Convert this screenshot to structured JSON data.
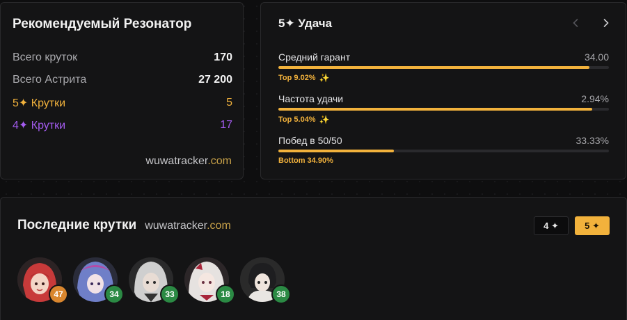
{
  "resonator": {
    "title": "Рекомендуемый Резонатор",
    "stats": [
      {
        "label": "Всего круток",
        "value": "170"
      },
      {
        "label": "Всего Астрита",
        "value": "27 200"
      },
      {
        "label": "5✦ Крутки",
        "value": "5"
      },
      {
        "label": "4✦ Крутки",
        "value": "17"
      }
    ],
    "brand_name": "wuwatracker",
    "brand_domain": ".com"
  },
  "luck": {
    "title": "5✦ Удача",
    "prev_icon": "chevron-left-icon",
    "next_icon": "chevron-right-icon",
    "metrics": [
      {
        "label": "Средний гарант",
        "value": "34.00",
        "rank": "Top 9.02%",
        "fill": 0.94
      },
      {
        "label": "Частота удачи",
        "value": "2.94%",
        "rank": "Top 5.04%",
        "fill": 0.95
      },
      {
        "label": "Побед в 50/50",
        "value": "33.33%",
        "rank": "Bottom 34.90%",
        "fill": 0.35
      }
    ]
  },
  "recent": {
    "title": "Последние крутки",
    "brand_name": "wuwatracker",
    "brand_domain": ".com",
    "filters": [
      {
        "label": "4 ✦",
        "active": false
      },
      {
        "label": "5 ✦",
        "active": true
      }
    ],
    "pulls": [
      {
        "pity": "47",
        "badge_color": "#d9862e"
      },
      {
        "pity": "34",
        "badge_color": "#2b8a44"
      },
      {
        "pity": "33",
        "badge_color": "#2b8a44"
      },
      {
        "pity": "18",
        "badge_color": "#2b8a44"
      },
      {
        "pity": "38",
        "badge_color": "#2b8a44"
      }
    ]
  },
  "colors": {
    "accent_gold": "#f2b23c",
    "accent_purple": "#a45cf0",
    "badge_orange": "#d9862e",
    "badge_green": "#2b8a44"
  }
}
